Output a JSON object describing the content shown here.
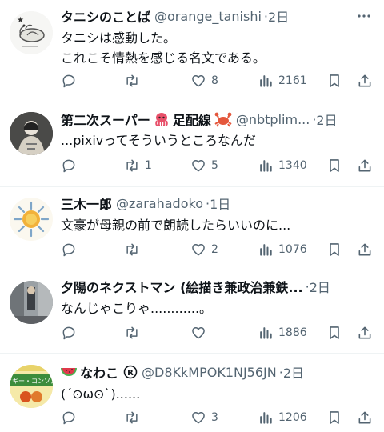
{
  "tweets": [
    {
      "name": "タニシのことば",
      "handle": "@orange_tanishi",
      "time": "2日",
      "body": "タニシは感動した。\nこれこそ情熱を感じる名文である。",
      "replies": "",
      "retweets": "",
      "likes": "8",
      "views": "2161",
      "avatar_icon": "snail-drawing-icon"
    },
    {
      "name": "第二次スーパー",
      "name_suffix": "足配線",
      "handle": "@nbtplim...",
      "time": "2日",
      "body": "...pixivってそういうところなんだ",
      "replies": "",
      "retweets": "1",
      "likes": "5",
      "views": "1340",
      "avatar_icon": "portrait-photo-icon",
      "name_emojis": [
        "octopus-emoji",
        "crab-emoji"
      ]
    },
    {
      "name": "三木一郎",
      "handle": "@zarahadoko",
      "time": "1日",
      "body": "文豪が母親の前で朗読したらいいのに...",
      "replies": "",
      "retweets": "",
      "likes": "2",
      "views": "1076",
      "avatar_icon": "sun-icon"
    },
    {
      "name": "夕陽のネクストマン (絵描き兼政治兼鉄...",
      "handle": "",
      "time": "2日",
      "body": "なんじゃこりゃ............。",
      "replies": "",
      "retweets": "",
      "likes": "",
      "views": "1886",
      "avatar_icon": "street-photo-icon"
    },
    {
      "name": "なわこ",
      "handle": "@D8KkMPOK1NJ56JN",
      "time": "2日",
      "body": "(´⊙ω⊙`)......",
      "replies": "",
      "retweets": "",
      "likes": "3",
      "views": "1206",
      "avatar_icon": "food-package-icon",
      "avatar_text": "マギー・コンソメ",
      "name_emojis": [
        "watermelon-emoji",
        "registered-icon"
      ]
    }
  ],
  "dot": "·",
  "colors": {
    "text": "#0f1419",
    "secondary": "#536471",
    "divider": "#eff3f4"
  }
}
